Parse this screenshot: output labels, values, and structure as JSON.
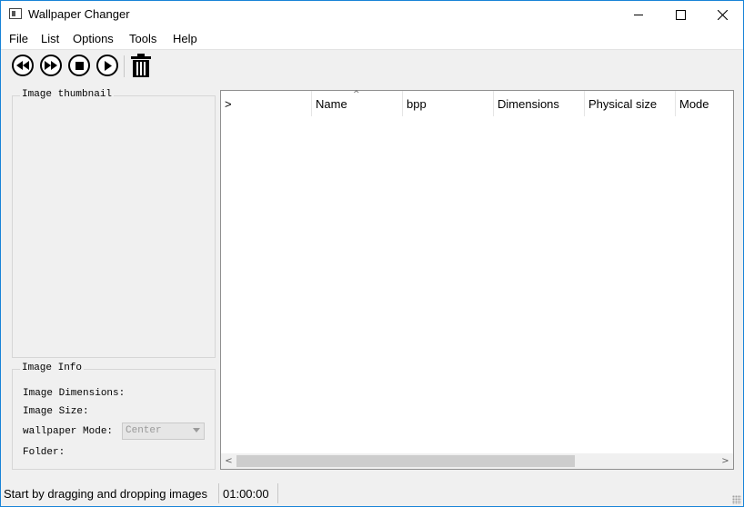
{
  "window": {
    "title": "Wallpaper Changer"
  },
  "menu": {
    "items": [
      "File",
      "List",
      "Options",
      "Tools",
      "Help"
    ]
  },
  "toolbar": {
    "buttons": [
      {
        "icon": "rewind-icon"
      },
      {
        "icon": "fast-forward-icon"
      },
      {
        "icon": "stop-icon"
      },
      {
        "icon": "play-icon"
      },
      {
        "icon": "trash-icon"
      }
    ]
  },
  "thumbnail_group": {
    "title": "Image thumbnail"
  },
  "info_group": {
    "title": "Image Info",
    "dimensions_label": "Image Dimensions:",
    "size_label": "Image Size:",
    "mode_label": "wallpaper Mode:",
    "mode_value": "Center",
    "folder_label": "Folder:"
  },
  "list": {
    "columns": [
      ">",
      "Name",
      "bpp",
      "Dimensions",
      "Physical size",
      "Mode"
    ],
    "sorted_column": "Name",
    "rows": []
  },
  "status": {
    "message": "Start by dragging and dropping images",
    "timer": "01:00:00"
  },
  "colors": {
    "window_border": "#1883d7",
    "background": "#f0f0f0"
  }
}
